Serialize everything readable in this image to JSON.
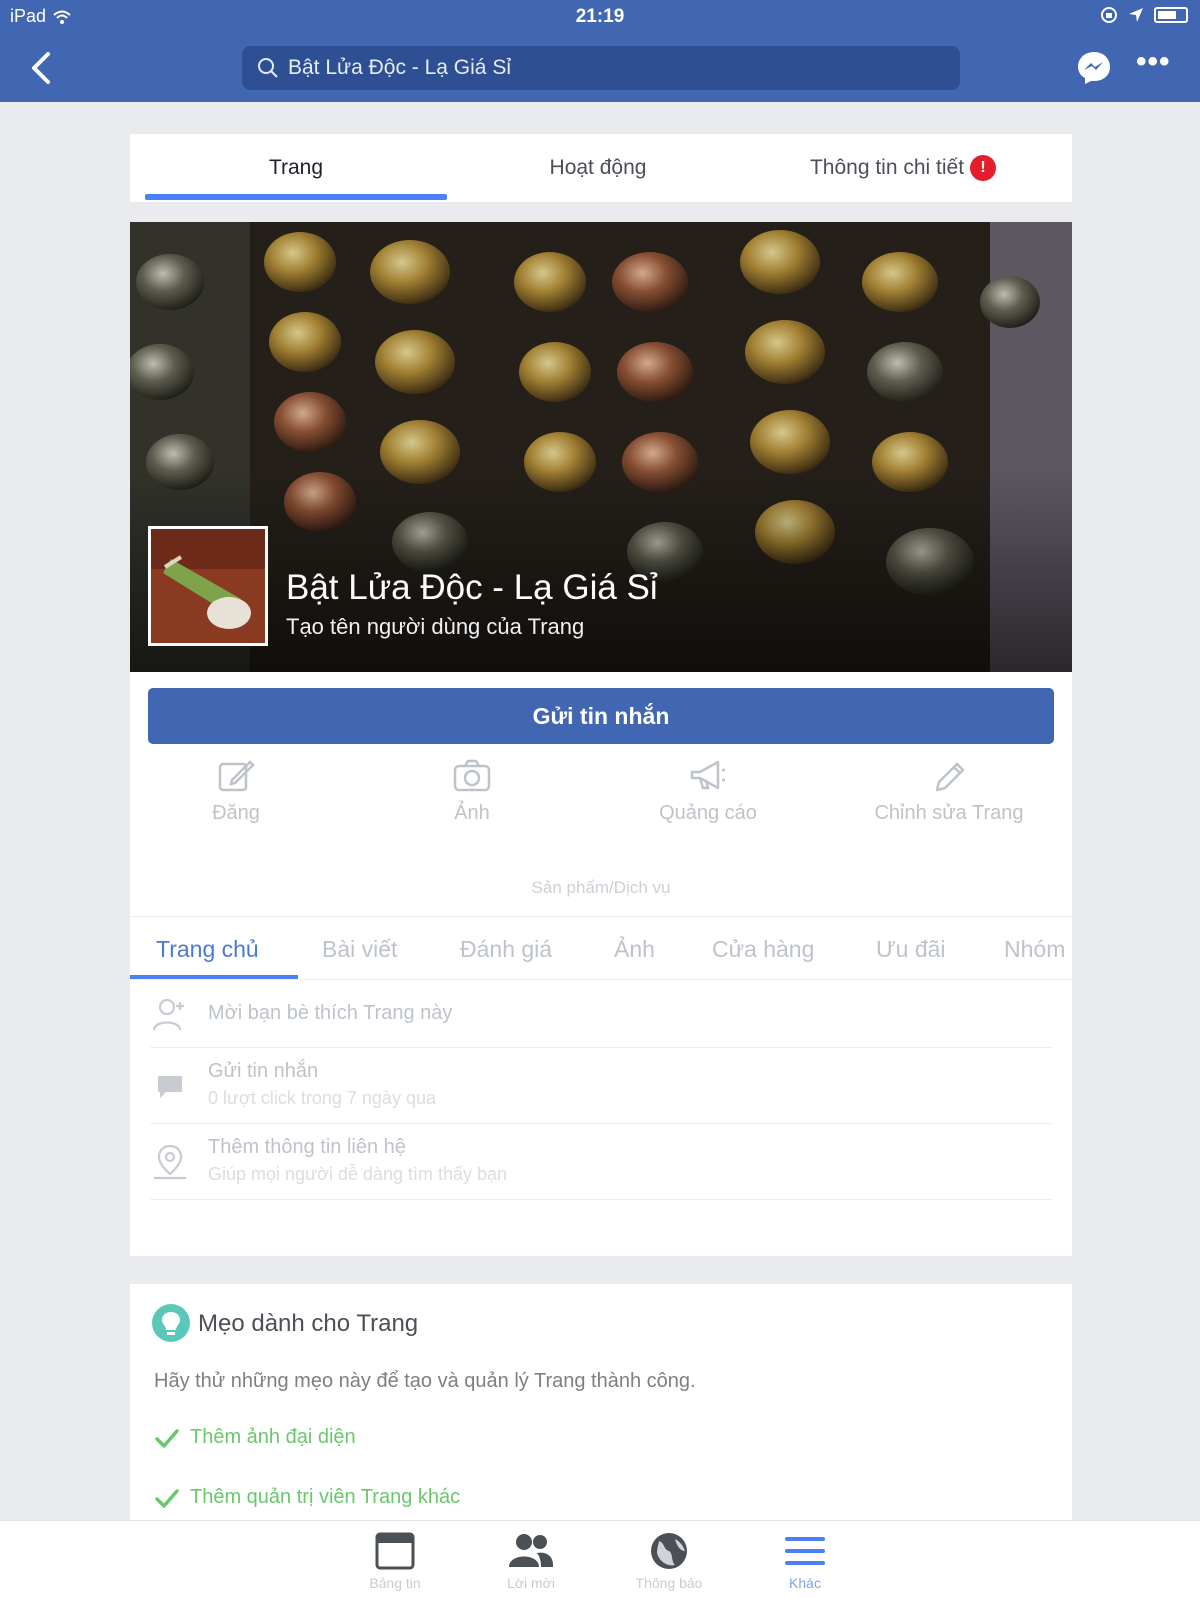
{
  "status_bar": {
    "device": "iPad",
    "time": "21:19"
  },
  "nav": {
    "search_text": "Bật Lửa Độc - Lạ Giá Sỉ"
  },
  "page_tabs": [
    {
      "label": "Trang",
      "active": true
    },
    {
      "label": "Hoạt động",
      "active": false
    },
    {
      "label": "Thông tin chi tiết",
      "active": false,
      "badge": "!"
    }
  ],
  "cover": {
    "page_name": "Bật Lửa Độc - Lạ Giá Sỉ",
    "subtitle": "Tạo tên người dùng của Trang"
  },
  "send_message_label": "Gửi tin nhắn",
  "actions": [
    {
      "label": "Đăng",
      "icon": "edit-icon"
    },
    {
      "label": "Ảnh",
      "icon": "camera-icon"
    },
    {
      "label": "Quảng cáo",
      "icon": "megaphone-icon"
    },
    {
      "label": "Chỉnh sửa Trang",
      "icon": "pencil-icon"
    }
  ],
  "category": "Sản phẩm/Dịch vụ",
  "sub_tabs": [
    {
      "label": "Trang chủ",
      "active": true
    },
    {
      "label": "Bài viết"
    },
    {
      "label": "Đánh giá"
    },
    {
      "label": "Ảnh"
    },
    {
      "label": "Cửa hàng"
    },
    {
      "label": "Ưu đãi"
    },
    {
      "label": "Nhóm"
    }
  ],
  "rows": [
    {
      "title": "Mời bạn bè thích Trang này",
      "icon": "invite-friend-icon"
    },
    {
      "title": "Gửi tin nhắn",
      "subtitle": "0 lượt click trong 7 ngày qua",
      "icon": "message-icon"
    },
    {
      "title": "Thêm thông tin liên hệ",
      "subtitle": "Giúp mọi người dễ dàng tìm thấy bạn",
      "icon": "location-icon"
    }
  ],
  "tips": {
    "title": "Mẹo dành cho Trang",
    "description": "Hãy thử những mẹo này để tạo và quản lý Trang thành công.",
    "items": [
      "Thêm ảnh đại diện",
      "Thêm quản trị viên Trang khác"
    ]
  },
  "tab_bar": [
    {
      "label": "Bảng tin",
      "icon": "news-feed-icon"
    },
    {
      "label": "Lời mời",
      "icon": "friend-requests-icon"
    },
    {
      "label": "Thông báo",
      "icon": "globe-icon"
    },
    {
      "label": "Khác",
      "icon": "menu-icon",
      "active": true
    }
  ],
  "colors": {
    "brand": "#4267b2",
    "active_tab": "#4a80f5",
    "badge": "#e41e2d",
    "tip_green": "#6bc76b"
  }
}
